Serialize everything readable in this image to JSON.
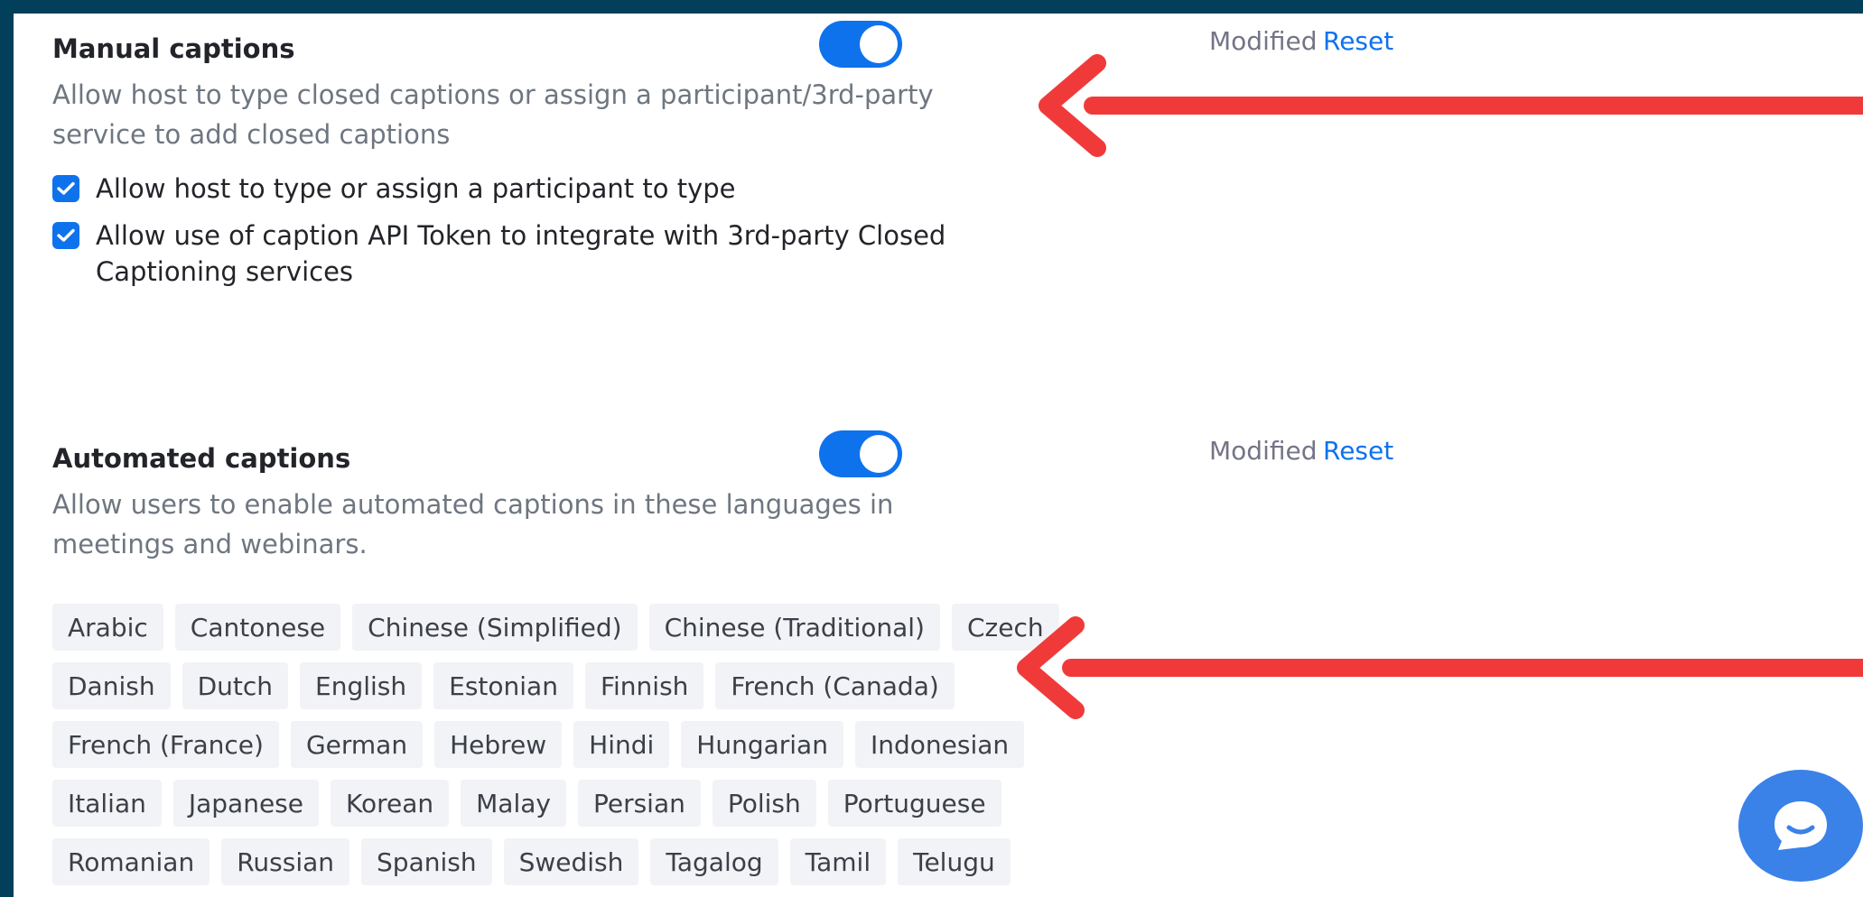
{
  "manual_captions": {
    "title": "Manual captions",
    "description": "Allow host to type closed captions or assign a participant/3rd-party service to add closed captions",
    "options": [
      {
        "label": "Allow host to type or assign a participant to type",
        "checked": true
      },
      {
        "label": "Allow use of caption API Token to integrate with 3rd-party Closed Captioning services",
        "checked": true
      }
    ],
    "enabled": true,
    "status": "Modified",
    "reset_label": "Reset"
  },
  "automated_captions": {
    "title": "Automated captions",
    "description": "Allow users to enable automated captions in these languages in meetings and webinars.",
    "enabled": true,
    "status": "Modified",
    "reset_label": "Reset",
    "languages": [
      [
        "Arabic",
        "Cantonese",
        "Chinese (Simplified)",
        "Chinese (Traditional)",
        "Czech"
      ],
      [
        "Danish",
        "Dutch",
        "English",
        "Estonian",
        "Finnish",
        "French (Canada)"
      ],
      [
        "French (France)",
        "German",
        "Hebrew",
        "Hindi",
        "Hungarian",
        "Indonesian"
      ],
      [
        "Italian",
        "Japanese",
        "Korean",
        "Malay",
        "Persian",
        "Polish",
        "Portuguese"
      ],
      [
        "Romanian",
        "Russian",
        "Spanish",
        "Swedish",
        "Tagalog",
        "Tamil",
        "Telugu"
      ]
    ]
  },
  "colors": {
    "frame": "#013f5b",
    "accent": "#0e72ed",
    "annotation_arrow": "#f03a3a",
    "chat_button": "#3a82e8"
  },
  "icons": [
    "check-icon",
    "chat-bubble-icon",
    "arrow-left-icon"
  ]
}
